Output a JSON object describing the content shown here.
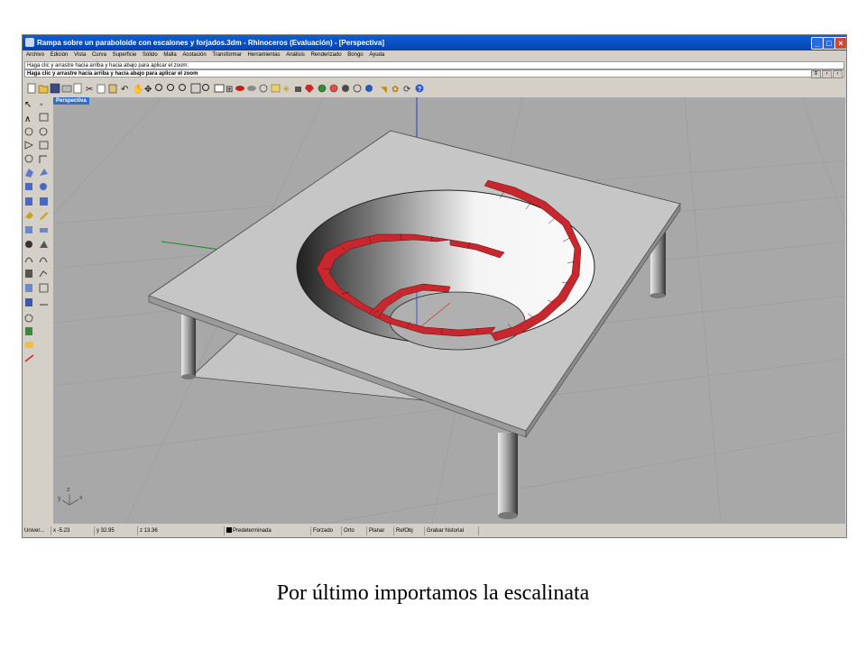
{
  "window": {
    "title": "Rampa sobre un paraboloide con escalones y forjados.3dm - Rhinoceros (Evaluación) - [Perspectiva]"
  },
  "menu": [
    "Archivo",
    "Edición",
    "Vista",
    "Curva",
    "Superficie",
    "Sólido",
    "Malla",
    "Acotación",
    "Transformar",
    "Herramientas",
    "Análisis",
    "Renderizado",
    "Bongo",
    "Ayuda"
  ],
  "command": {
    "history": "Haga clic y arrastre hacia arriba y hacia abajo para aplicar el zoom:",
    "prompt": "Haga clic y arrastre hacia arriba y hacia abajo para aplicar el zoom"
  },
  "viewport": {
    "label": "Perspectiva",
    "axis_x": "x",
    "axis_y": "y",
    "axis_z": "z"
  },
  "status": {
    "units": "Univer...",
    "x": "x -5.23",
    "y": "y 32.95",
    "z": "z 13.36",
    "layer": "Predeterminada",
    "snap": "Forzado",
    "ortho": "Orto",
    "planar": "Planar",
    "osnap": "RefObj",
    "history": "Grabar historial"
  },
  "caption": "Por último importamos la escalinata",
  "colors": {
    "titlebar": "#0a5fd8",
    "viewport_bg": "#a8a8a8",
    "steps": "#c8282d",
    "slab": "#c8c8c8"
  }
}
